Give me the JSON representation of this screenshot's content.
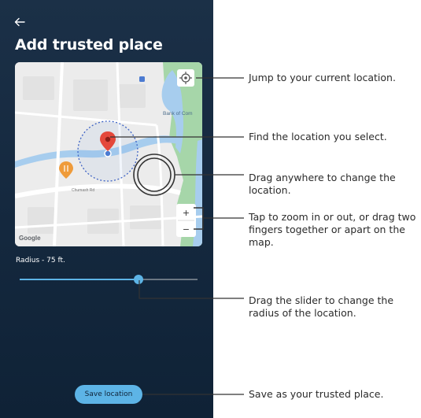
{
  "screen": {
    "title": "Add trusted place",
    "back_icon": "arrow-left-icon",
    "map": {
      "street_label": "Chumash Rd",
      "poi_label": "Bank of Com",
      "brand": "Google",
      "zoom_in_label": "+",
      "zoom_out_label": "−"
    },
    "radius_label": "Radius - 75 ft.",
    "radius_slider_fraction": 0.67,
    "save_button_label": "Save location"
  },
  "callouts": {
    "current_location": "Jump to your current location.",
    "find_location": "Find the location you select.",
    "drag_map": "Drag anywhere to change the location.",
    "zoom": "Tap to zoom in or out, or drag two fingers together or apart on the map.",
    "slider": "Drag the slider to change the radius of the location.",
    "save": "Save as your trusted place."
  },
  "colors": {
    "phone_bg": "#14283e",
    "accent": "#5db4e6",
    "water": "#a7cdee",
    "park": "#a6d6a9",
    "road": "#ffffff",
    "pin": "#e4483b",
    "poi": "#ef9b3a"
  }
}
